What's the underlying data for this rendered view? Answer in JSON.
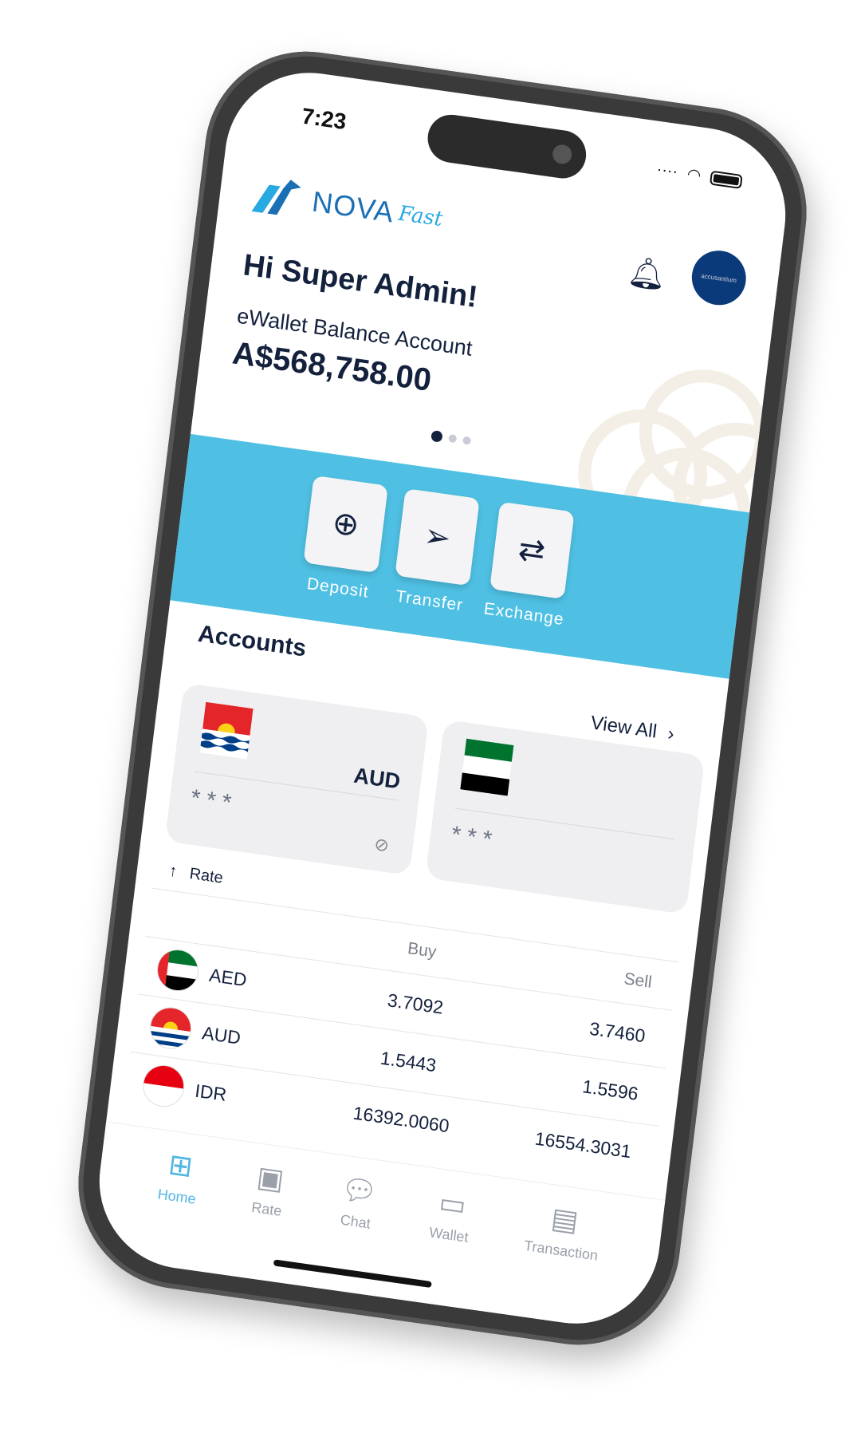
{
  "status": {
    "time": "7:23"
  },
  "brand": {
    "name": "NOVA",
    "suffix": "Fast",
    "primary": "#1b6fb5",
    "accent": "#27a9e1"
  },
  "header": {
    "avatar_text": "accusantium",
    "bell_icon": "bell-icon"
  },
  "greeting": "Hi Super Admin!",
  "balance": {
    "label": "eWallet Balance Account",
    "amount": "A$568,758.00"
  },
  "carousel": {
    "pages": 3,
    "active": 1
  },
  "actions": [
    {
      "label": "Deposit",
      "icon": "plus-circle-icon"
    },
    {
      "label": "Transfer",
      "icon": "paper-plane-icon"
    },
    {
      "label": "Exchange",
      "icon": "arrows-exchange-icon"
    }
  ],
  "accounts": {
    "title": "Accounts",
    "view_all": "View All",
    "cards": [
      {
        "currency": "AUD",
        "masked": "***"
      },
      {
        "currency": "",
        "masked": "***"
      }
    ]
  },
  "rate": {
    "title": "Rate",
    "columns": [
      "",
      "Buy",
      "Sell"
    ],
    "rows": [
      {
        "currency": "AED",
        "buy": "3.7092",
        "sell": "3.7460"
      },
      {
        "currency": "AUD",
        "buy": "1.5443",
        "sell": "1.5596"
      },
      {
        "currency": "IDR",
        "buy": "16392.0060",
        "sell": "16554.3031"
      }
    ]
  },
  "nav": [
    {
      "label": "Home",
      "active": true
    },
    {
      "label": "Rate"
    },
    {
      "label": "Chat"
    },
    {
      "label": "Wallet"
    },
    {
      "label": "Transaction"
    }
  ],
  "colors": {
    "band": "#4fc0e3",
    "navy": "#13213f"
  }
}
